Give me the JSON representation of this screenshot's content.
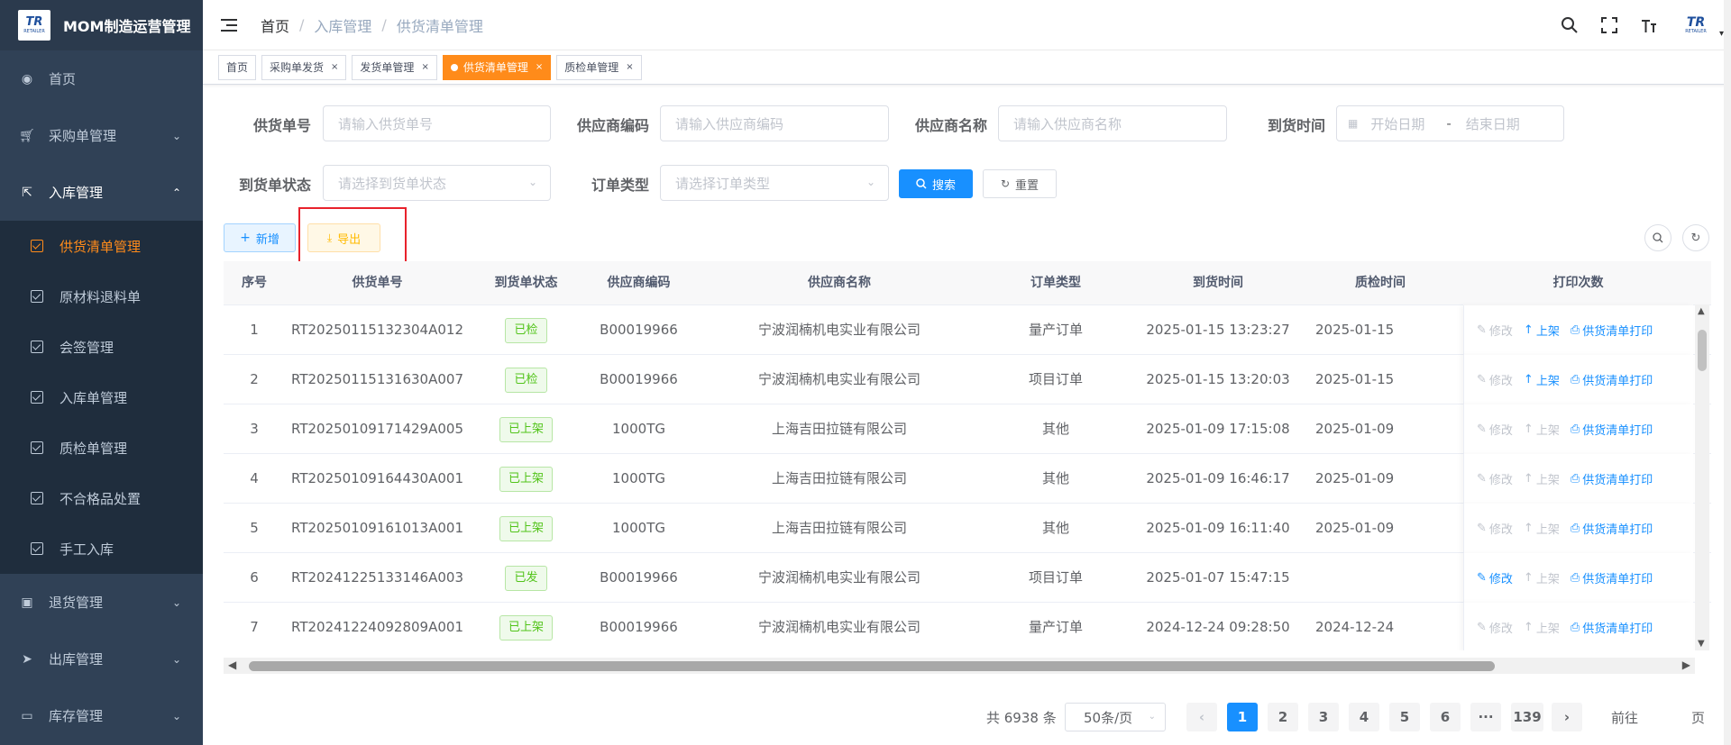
{
  "app": {
    "title": "MOM制造运营管理",
    "logo_text": "TR",
    "logo_sub": "RETAILER"
  },
  "sidebar": {
    "items": [
      {
        "label": "首页",
        "icon": "dashboard-icon"
      },
      {
        "label": "采购单管理",
        "icon": "cart-icon"
      },
      {
        "label": "入库管理",
        "icon": "external-link-icon"
      },
      {
        "label": "退货管理",
        "icon": "return-icon"
      },
      {
        "label": "出库管理",
        "icon": "send-icon"
      },
      {
        "label": "库存管理",
        "icon": "monitor-icon"
      }
    ],
    "submenu": [
      {
        "label": "供货清单管理",
        "active": true
      },
      {
        "label": "原材料退料单"
      },
      {
        "label": "会签管理"
      },
      {
        "label": "入库单管理"
      },
      {
        "label": "质检单管理"
      },
      {
        "label": "不合格品处置"
      },
      {
        "label": "手工入库"
      }
    ]
  },
  "breadcrumb": [
    "首页",
    "入库管理",
    "供货清单管理"
  ],
  "tags": [
    {
      "label": "首页"
    },
    {
      "label": "采购单发货"
    },
    {
      "label": "发货单管理"
    },
    {
      "label": "供货清单管理",
      "active": true
    },
    {
      "label": "质检单管理"
    }
  ],
  "filters": {
    "supply_no_label": "供货单号",
    "supply_no_placeholder": "请输入供货单号",
    "vendor_code_label": "供应商编码",
    "vendor_code_placeholder": "请输入供应商编码",
    "vendor_name_label": "供应商名称",
    "vendor_name_placeholder": "请输入供应商名称",
    "arrival_label": "到货时间",
    "start_placeholder": "开始日期",
    "range_sep": "-",
    "end_placeholder": "结束日期",
    "status_label": "到货单状态",
    "status_placeholder": "请选择到货单状态",
    "order_type_label": "订单类型",
    "order_type_placeholder": "请选择订单类型",
    "search_label": "搜索",
    "reset_label": "重置"
  },
  "toolbar": {
    "add_label": "新增",
    "export_label": "导出"
  },
  "table": {
    "headers": [
      "序号",
      "供货单号",
      "到货单状态",
      "供应商编码",
      "供应商名称",
      "订单类型",
      "到货时间",
      "质检时间",
      "打印次数"
    ],
    "rows": [
      {
        "idx": "1",
        "no": "RT20250115132304A012",
        "status": "已检",
        "code": "B00019966",
        "name": "宁波润楠机电实业有限公司",
        "type": "量产订单",
        "arrival": "2025-01-15 13:23:27",
        "qc": "2025-01-15",
        "edit_enabled": false,
        "shelf_enabled": true
      },
      {
        "idx": "2",
        "no": "RT20250115131630A007",
        "status": "已检",
        "code": "B00019966",
        "name": "宁波润楠机电实业有限公司",
        "type": "项目订单",
        "arrival": "2025-01-15 13:20:03",
        "qc": "2025-01-15",
        "edit_enabled": false,
        "shelf_enabled": true
      },
      {
        "idx": "3",
        "no": "RT20250109171429A005",
        "status": "已上架",
        "code": "1000TG",
        "name": "上海吉田拉链有限公司",
        "type": "其他",
        "arrival": "2025-01-09 17:15:08",
        "qc": "2025-01-09",
        "edit_enabled": false,
        "shelf_enabled": false
      },
      {
        "idx": "4",
        "no": "RT20250109164430A001",
        "status": "已上架",
        "code": "1000TG",
        "name": "上海吉田拉链有限公司",
        "type": "其他",
        "arrival": "2025-01-09 16:46:17",
        "qc": "2025-01-09",
        "edit_enabled": false,
        "shelf_enabled": false
      },
      {
        "idx": "5",
        "no": "RT20250109161013A001",
        "status": "已上架",
        "code": "1000TG",
        "name": "上海吉田拉链有限公司",
        "type": "其他",
        "arrival": "2025-01-09 16:11:40",
        "qc": "2025-01-09",
        "edit_enabled": false,
        "shelf_enabled": false
      },
      {
        "idx": "6",
        "no": "RT20241225133146A003",
        "status": "已发",
        "code": "B00019966",
        "name": "宁波润楠机电实业有限公司",
        "type": "项目订单",
        "arrival": "2025-01-07 15:47:15",
        "qc": "",
        "edit_enabled": true,
        "shelf_enabled": false
      },
      {
        "idx": "7",
        "no": "RT20241224092809A001",
        "status": "已上架",
        "code": "B00019966",
        "name": "宁波润楠机电实业有限公司",
        "type": "量产订单",
        "arrival": "2024-12-24 09:28:50",
        "qc": "2024-12-24",
        "edit_enabled": false,
        "shelf_enabled": false
      }
    ],
    "ops": {
      "edit": "修改",
      "shelf": "上架",
      "print": "供货清单打印"
    }
  },
  "pagination": {
    "total": "共 6938 条",
    "page_size": "50条/页",
    "pages": [
      "1",
      "2",
      "3",
      "4",
      "5",
      "6",
      "···",
      "139"
    ],
    "current": "1",
    "goto_label": "前往",
    "page_unit": "页"
  },
  "colors": {
    "accent": "#ff8b1a",
    "primary": "#1890ff",
    "sidebar": "#304156",
    "success": "#52c41a",
    "highlight": "#e8222c"
  }
}
